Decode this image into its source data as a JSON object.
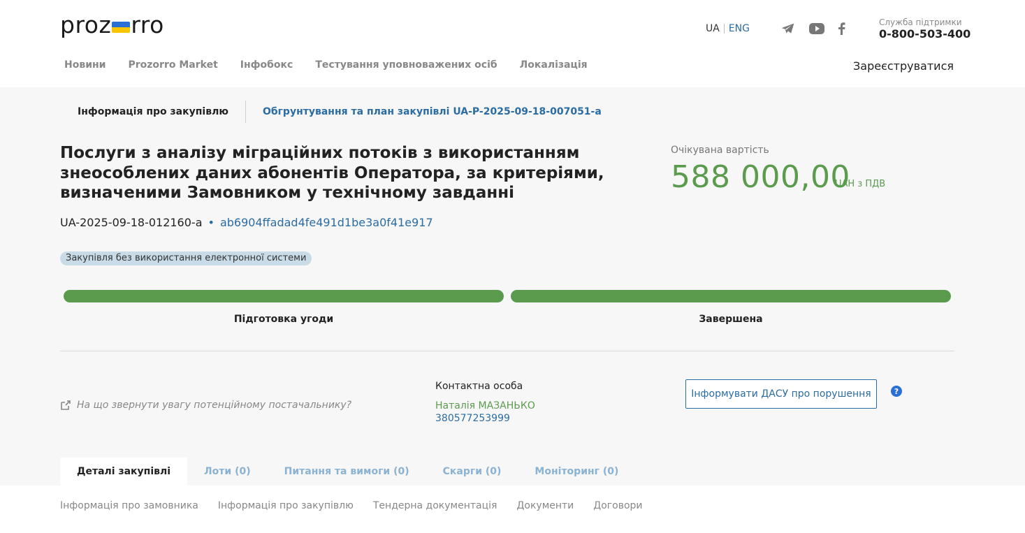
{
  "header": {
    "logo_left": "proz",
    "logo_right": "rro",
    "lang_ua": "UA",
    "lang_eng": "ENG",
    "support_label": "Служба підтримки",
    "support_phone": "0-800-503-400",
    "register": "Зареєструватися"
  },
  "nav": [
    {
      "label": "Новини"
    },
    {
      "label": "Prozorro Market"
    },
    {
      "label": "Інфобокс"
    },
    {
      "label": "Тестування уповноважених осіб"
    },
    {
      "label": "Локалізація"
    }
  ],
  "info_tabs": {
    "procurement_info": "Інформація про закупівлю",
    "plan_link": "Обгрунтування та план закупівлі UA-P-2025-09-18-007051-a"
  },
  "tender": {
    "title": "Послуги з аналізу міграційних потоків з використанням знеособлених даних абонентів Оператора, за критеріями, визначеними Замовником у технічному завданні",
    "id": "UA-2025-09-18-012160-a",
    "separator": "•",
    "hash": "ab6904ffadad4fe491d1be3a0f41e917",
    "badge": "Закупівля без використання електронної системи",
    "expected_label": "Очікувана вартість",
    "expected_value": "588 000,00",
    "expected_unit": "UAH з ПДВ"
  },
  "stages": [
    {
      "label": "Підготовка угоди",
      "progress": 1.0
    },
    {
      "label": "Завершена",
      "progress": 1.0
    }
  ],
  "attention": {
    "text": "На що звернути увагу потенційному постачальнику?"
  },
  "contact": {
    "title": "Контактна особа",
    "name": "Наталія МАЗАНЬКО",
    "phone": "380577253999"
  },
  "dasu_button": "Інформувати ДАСУ про порушення",
  "help_icon_label": "?",
  "bottom_tabs": [
    {
      "label": "Деталі закупівлі"
    },
    {
      "label": "Лоти (0)"
    },
    {
      "label": "Питання та вимоги (0)"
    },
    {
      "label": "Скарги (0)"
    },
    {
      "label": "Моніторинг (0)"
    }
  ],
  "subnav": [
    {
      "label": "Інформація про замовника"
    },
    {
      "label": "Інформація про закупівлю"
    },
    {
      "label": "Тендерна документація"
    },
    {
      "label": "Документи"
    },
    {
      "label": "Договори"
    }
  ],
  "colors": {
    "accent_green": "#5b9b4e",
    "link_blue": "#2b6ca3",
    "flag_blue": "#2a6fd6",
    "flag_yellow": "#f7c600",
    "badge_bg": "#c8dbe6"
  },
  "icons": {
    "telegram": "telegram-icon",
    "youtube": "youtube-icon",
    "facebook": "facebook-icon",
    "external_link": "external-link-icon",
    "help": "question-circle-icon"
  }
}
